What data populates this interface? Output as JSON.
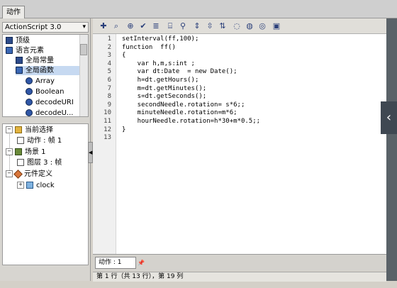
{
  "window_tab": "动作",
  "actionscript_version": "ActionScript 3.0",
  "tree1": {
    "items": [
      {
        "label": "顶级",
        "icon": "book-icon"
      },
      {
        "label": "语言元素",
        "icon": "book-open-icon"
      },
      {
        "label": "全局常量",
        "icon": "book-icon"
      },
      {
        "label": "全局函数",
        "icon": "book-open-icon"
      },
      {
        "label": "Array",
        "icon": "function-icon"
      },
      {
        "label": "Boolean",
        "icon": "function-icon"
      },
      {
        "label": "decodeURI",
        "icon": "function-icon"
      },
      {
        "label": "decodeU...",
        "icon": "function-icon"
      }
    ]
  },
  "tree2": {
    "items": [
      {
        "label": "当前选择",
        "icon": "selection-icon"
      },
      {
        "label": "动作 : 帧 1",
        "icon": "frame-icon"
      },
      {
        "label": "场景 1",
        "icon": "scene-icon"
      },
      {
        "label": "图层 3 : 帧",
        "icon": "frame-icon"
      },
      {
        "label": "元件定义",
        "icon": "symbol-icon"
      },
      {
        "label": "clock",
        "icon": "movieclip-icon"
      }
    ]
  },
  "toolbar": {
    "icons": [
      "add-icon",
      "search-icon",
      "target-icon",
      "check-icon",
      "format-icon",
      "code-hint-icon",
      "debug-icon",
      "collapse-icon",
      "collapse-selection-icon",
      "expand-icon",
      "comment-block-icon",
      "comment-line-icon",
      "uncomment-icon",
      "toolbox-icon"
    ]
  },
  "code": {
    "line_numbers": [
      "1",
      "2",
      "3",
      "4",
      "5",
      "6",
      "7",
      "8",
      "9",
      "10",
      "11",
      "12",
      "13"
    ],
    "lines": [
      "setInterval(ff,100);",
      "function  ff()",
      "{",
      "    var h,m,s:int ;",
      "    var dt:Date  = new Date();",
      "    h=dt.getHours();",
      "    m=dt.getMinutes();",
      "    s=dt.getSeconds();",
      "    secondNeedle.rotation= s*6;;",
      "    minuteNeedle.rotation=m*6;",
      "    hourNeedle.rotation=h*30+m*0.5;;",
      "}",
      ""
    ]
  },
  "editor_tab": "动作 : 1",
  "status": "第 1 行（共 13 行），第 19 列",
  "nav_arrow": "‹"
}
